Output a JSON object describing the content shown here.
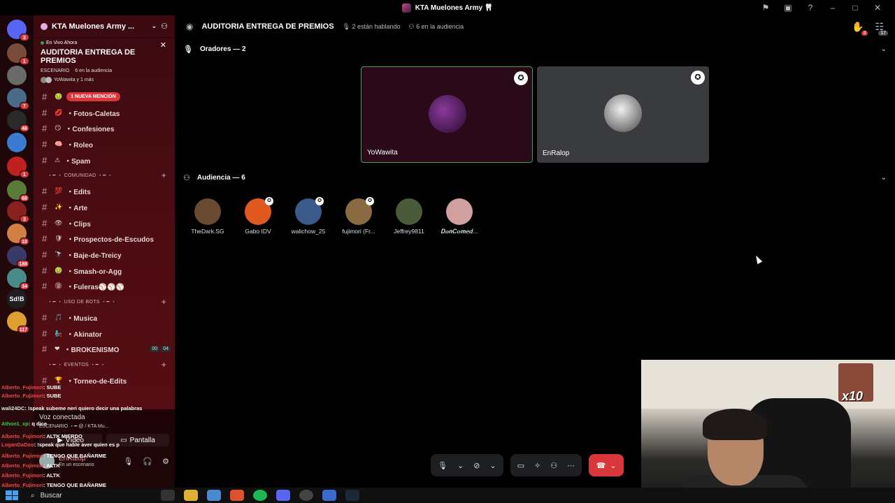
{
  "window": {
    "title": "KTA Muelones Army 🦷"
  },
  "titlebar_icons": [
    "flag-icon",
    "inbox-icon",
    "help-icon",
    "minimize-icon",
    "maximize-icon",
    "close-icon"
  ],
  "servers": [
    {
      "badge": "2",
      "color": "#5865f2"
    },
    {
      "badge": "1",
      "color": "#7a4a3a"
    },
    {
      "badge": "",
      "color": "#6a6a6a"
    },
    {
      "badge": "7",
      "color": "#4a6a8a"
    },
    {
      "badge": "46",
      "color": "#2a2a2a"
    },
    {
      "badge": "",
      "color": "#3a7ad0"
    },
    {
      "badge": "1",
      "color": "#c02020"
    },
    {
      "badge": "68",
      "color": "#5a7a3a"
    },
    {
      "badge": "3",
      "color": "#8a2020"
    },
    {
      "badge": "10",
      "color": "#d08040"
    },
    {
      "badge": "188",
      "color": "#3a3a6a"
    },
    {
      "badge": "34",
      "color": "#4a8a8a"
    },
    {
      "badge": "",
      "color": "#1e1f22",
      "text": "Sd!B"
    },
    {
      "badge": "117",
      "color": "#e0a030"
    }
  ],
  "guild": {
    "name": "KTA Muelones Army ...",
    "chevron": "⌄"
  },
  "stage_card": {
    "live": "En Vivo Ahora",
    "title": "AUDITORIA ENTREGA DE PREMIOS",
    "category": "ESCENARIO",
    "audience": "6 en la audiencia",
    "speakers": "YoWawita y 1 más"
  },
  "channels": [
    {
      "emoji": "🤢",
      "name": "",
      "mention": "1 NUEVA MENCIÓN"
    },
    {
      "emoji": "💋",
      "name": "・Fotos-Caletas"
    },
    {
      "emoji": "😏",
      "name": "・Confesiones"
    },
    {
      "emoji": "🧠",
      "name": "・Roleo"
    },
    {
      "emoji": "⚠",
      "name": "・Spam"
    }
  ],
  "cat_comunidad": "・━ ・ COMUNIDAD ・━ ・",
  "channels_comunidad": [
    {
      "emoji": "💯",
      "name": "・Edits"
    },
    {
      "emoji": "✨",
      "name": "・Arte"
    },
    {
      "emoji": "👁",
      "name": "・Clips"
    },
    {
      "emoji": "🛡",
      "name": "・Prospectos-de-Escudos"
    },
    {
      "emoji": "🔭",
      "name": "・Baje-de-Treicy"
    },
    {
      "emoji": "🤢",
      "name": "・Smash-or-Agg"
    },
    {
      "emoji": "🔞",
      "name": "・Fuleras⚾⚾⚾"
    }
  ],
  "cat_bots": "・━ ・ USO DE BOTS ・━ ・",
  "channels_bots": [
    {
      "emoji": "🎵",
      "name": "・Musica"
    },
    {
      "emoji": "🧞",
      "name": "・Akinator"
    },
    {
      "emoji": "❤",
      "name": "・BROKENISMO",
      "time": [
        "00",
        "04"
      ]
    }
  ],
  "cat_eventos": "・━ ・ EVENTOS ・━ ・",
  "channels_eventos": [
    {
      "emoji": "🏆",
      "name": "・Torneo-de-Edits"
    }
  ],
  "voice": {
    "connected": "Voz conectada",
    "sub": "ESCENARIO ・━ @ / KTA Mu...",
    "video": "Vídeo",
    "screen": "Pantalla",
    "user": "EnRalop",
    "user_status": "En un escenario"
  },
  "chat_overlay": [
    {
      "user": "Alberto_Fujimori",
      "msg": ": SUBE",
      "color": "#e84a4a"
    },
    {
      "user": "Alberto_Fujimori",
      "msg": ": SUBE",
      "color": "#e84a4a"
    },
    {
      "user": "wali24DC",
      "msg": ": !speak subeme neri quiero decir una palabras",
      "color": "#e6e6e6"
    },
    {
      "user": "Athon1_xp",
      "msg": ": q dice",
      "color": "#3ad03a"
    },
    {
      "user": "Alberto_Fujimori",
      "msg": ": ALTK MIERDO",
      "color": "#e84a4a"
    },
    {
      "user": "LoganDaDoo",
      "msg": ": !speak que hable aver quien es p",
      "color": "#e84a4a"
    },
    {
      "user": "Alberto_Fujimori",
      "msg": ": TENGO QUE BAÑARME",
      "color": "#e84a4a"
    },
    {
      "user": "Alberto_Fujimori",
      "msg": ": ALTK",
      "color": "#e84a4a"
    },
    {
      "user": "Alberto_Fujimori",
      "msg": ": ALTK",
      "color": "#e84a4a"
    },
    {
      "user": "Alberto_Fujimori",
      "msg": ": TENGO QUE BAÑARME",
      "color": "#e84a4a"
    }
  ],
  "topbar": {
    "title": "AUDITORIA ENTREGA DE PREMIOS",
    "speaking": "2 están hablando",
    "audience": "6 en la audiencia",
    "hand_badge": "3",
    "people_badge": "17"
  },
  "speakers_header": "Oradores — 2",
  "speakers": [
    {
      "name": "YoWawita",
      "bg": "#2a0a18",
      "ring": "#3ba55d"
    },
    {
      "name": "EnRalop",
      "bg": "#3a3b3e",
      "ring": ""
    }
  ],
  "audience_header": "Audiencia — 6",
  "audience": [
    {
      "name": "TheDark.SG",
      "color": "#6a4a30",
      "mod": false
    },
    {
      "name": "Gabo IDV",
      "color": "#e05a20",
      "mod": true
    },
    {
      "name": "walichow_25",
      "color": "#3a5a8a",
      "mod": true
    },
    {
      "name": "fujimori (Fr...",
      "color": "#8a6a40",
      "mod": true
    },
    {
      "name": "Jeffrey9811",
      "color": "#4a5a3a",
      "mod": false
    },
    {
      "name": "𝑫𝒐𝒏𝑪𝒐𝒎𝒆𝒅...",
      "color": "#d0a0a0",
      "mod": false
    }
  ],
  "webcam": {
    "overlay_text": "x10"
  },
  "taskbar": {
    "search": "Buscar"
  },
  "colors": {
    "accent": "#5865f2",
    "danger": "#da373c",
    "online": "#23a55a"
  }
}
